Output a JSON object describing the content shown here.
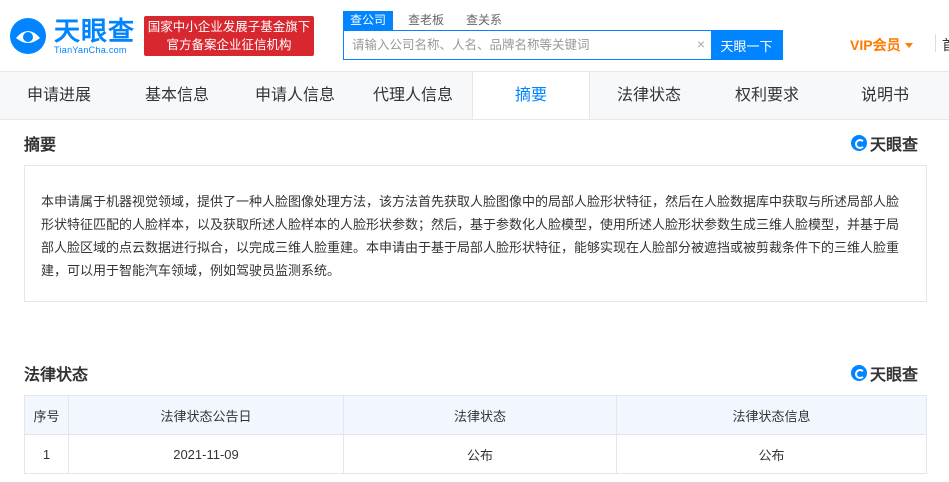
{
  "header": {
    "logo_cn": "天眼查",
    "logo_en": "TianYanCha.com",
    "gov_badge_line1": "国家中小企业发展子基金旗下",
    "gov_badge_line2": "官方备案企业征信机构",
    "search_tabs": [
      "查公司",
      "查老板",
      "查关系"
    ],
    "search_placeholder": "请输入公司名称、人名、品牌名称等关键词",
    "search_button": "天眼一下",
    "clear_glyph": "×",
    "vip_label": "VIP会员",
    "more_label": "首"
  },
  "tabs": [
    "申请进展",
    "基本信息",
    "申请人信息",
    "代理人信息",
    "摘要",
    "法律状态",
    "权利要求",
    "说明书"
  ],
  "active_tab": "摘要",
  "abstract": {
    "title": "摘要",
    "watermark": "天眼查",
    "text": "本申请属于机器视觉领域，提供了一种人脸图像处理方法，该方法首先获取人脸图像中的局部人脸形状特征，然后在人脸数据库中获取与所述局部人脸形状特征匹配的人脸样本，以及获取所述人脸样本的人脸形状参数；然后，基于参数化人脸模型，使用所述人脸形状参数生成三维人脸模型，并基于局部人脸区域的点云数据进行拟合，以完成三维人脸重建。本申请由于基于局部人脸形状特征，能够实现在人脸部分被遮挡或被剪裁条件下的三维人脸重建，可以用于智能汽车领域，例如驾驶员监测系统。"
  },
  "legal_status": {
    "title": "法律状态",
    "watermark": "天眼查",
    "columns": [
      "序号",
      "法律状态公告日",
      "法律状态",
      "法律状态信息"
    ],
    "rows": [
      [
        "1",
        "2021-11-09",
        "公布",
        "公布"
      ]
    ]
  },
  "colors": {
    "brand": "#0084ff",
    "gov_badge": "#d8272f",
    "vip": "#ff7a00",
    "table_header_bg": "#f2f7ff"
  }
}
